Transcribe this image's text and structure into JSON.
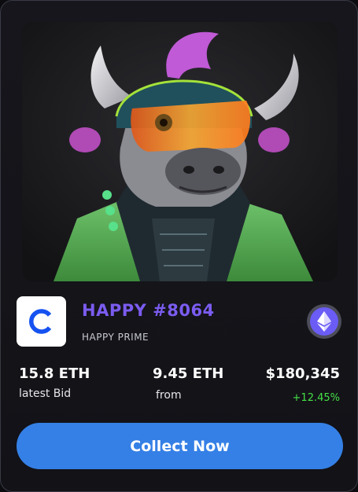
{
  "nft": {
    "title": "HAPPY #8064",
    "collection": "HAPPY PRIME"
  },
  "stats": {
    "latest_bid_value": "15.8 ETH",
    "latest_bid_label": "latest Bid",
    "from_value": "9.45 ETH",
    "from_label": "from",
    "usd_value": "$180,345",
    "change": "+12.45%"
  },
  "actions": {
    "collect_label": "Collect Now"
  },
  "icons": {
    "marketplace_logo": "coinbase-c-logo",
    "currency": "ethereum-icon"
  },
  "colors": {
    "accent_title": "#7b5cf0",
    "button": "#3580e6",
    "positive_change": "#46e046",
    "eth_badge": "#6a5cf5"
  }
}
